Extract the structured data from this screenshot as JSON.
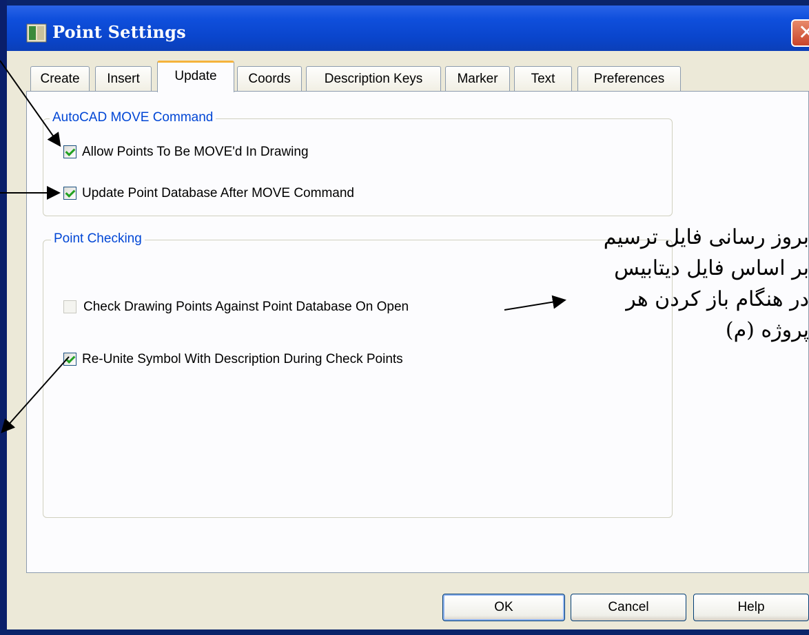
{
  "window": {
    "title": "Point Settings",
    "close_glyph": "✕"
  },
  "tabs": [
    {
      "label": "Create",
      "active": false
    },
    {
      "label": "Insert",
      "active": false
    },
    {
      "label": "Update",
      "active": true
    },
    {
      "label": "Coords",
      "active": false
    },
    {
      "label": "Description Keys",
      "active": false
    },
    {
      "label": "Marker",
      "active": false
    },
    {
      "label": "Text",
      "active": false
    },
    {
      "label": "Preferences",
      "active": false
    }
  ],
  "groups": {
    "move_command": {
      "label": "AutoCAD MOVE Command",
      "options": [
        {
          "label": "Allow Points To Be MOVE'd In Drawing",
          "checked": true,
          "enabled": true
        },
        {
          "label": "Update Point Database After MOVE Command",
          "checked": true,
          "enabled": true
        }
      ]
    },
    "point_checking": {
      "label": "Point Checking",
      "options": [
        {
          "label": "Check Drawing Points Against Point Database On Open",
          "checked": false,
          "enabled": false
        },
        {
          "label": "Re-Unite Symbol With Description During Check Points",
          "checked": true,
          "enabled": true
        }
      ]
    }
  },
  "buttons": {
    "ok": "OK",
    "cancel": "Cancel",
    "help": "Help"
  },
  "annotation": {
    "lines": [
      "بروز رسانی فایل ترسیم",
      "بر اساس فایل دیتابیس",
      "در هنگام باز کردن هر",
      "پروژه (م)"
    ]
  },
  "colors": {
    "titlebar": "#0a45cc",
    "group_label": "#0046d5",
    "active_tab_accent": "#f5b33c",
    "checkmark": "#21a121"
  }
}
